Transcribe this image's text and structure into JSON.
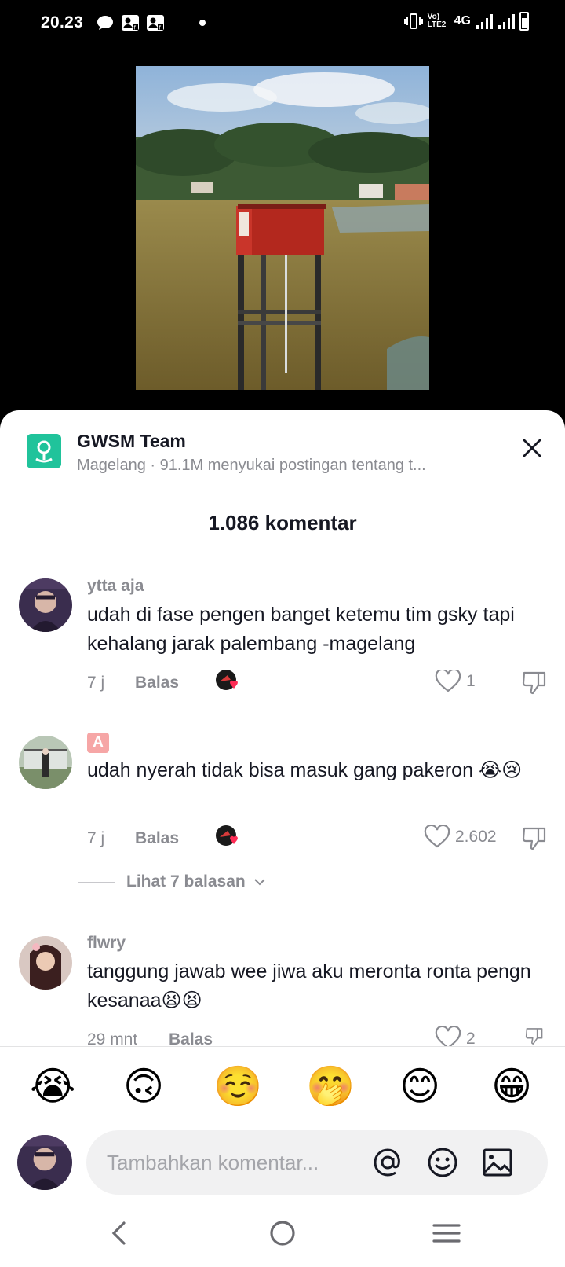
{
  "status_bar": {
    "time": "20.23",
    "network": "4G",
    "volte": "Vo) LTE2"
  },
  "header": {
    "title": "GWSM Team",
    "subtitle": "Magelang · 91.1M menyukai postingan tentang t..."
  },
  "comments_count": "1.086 komentar",
  "comments": [
    {
      "username": "ytta aja",
      "text": "udah di fase pengen banget ketemu tim gsky tapi kehalang jarak palembang -magelang",
      "time": "7 j",
      "reply_label": "Balas",
      "likes": "1"
    },
    {
      "username": "A",
      "text": "udah nyerah tidak bisa masuk gang pakeron 😭😢",
      "time": "7 j",
      "reply_label": "Balas",
      "likes": "2.602",
      "view_replies": "Lihat 7 balasan"
    },
    {
      "username": "flwry",
      "text": "tanggung jawab wee jiwa aku meronta ronta pengn kesanaa😫😫",
      "time": "29 mnt",
      "reply_label": "Balas",
      "likes": "2"
    }
  ],
  "emoji_bar": [
    "😭",
    "🙃",
    "☺️",
    "🤭",
    "😊",
    "😁"
  ],
  "input": {
    "placeholder": "Tambahkan komentar..."
  },
  "colors": {
    "accent_location": "#20C39B",
    "like_red": "#FE2C55",
    "text_primary": "#161823",
    "text_secondary": "#8A8B91"
  }
}
